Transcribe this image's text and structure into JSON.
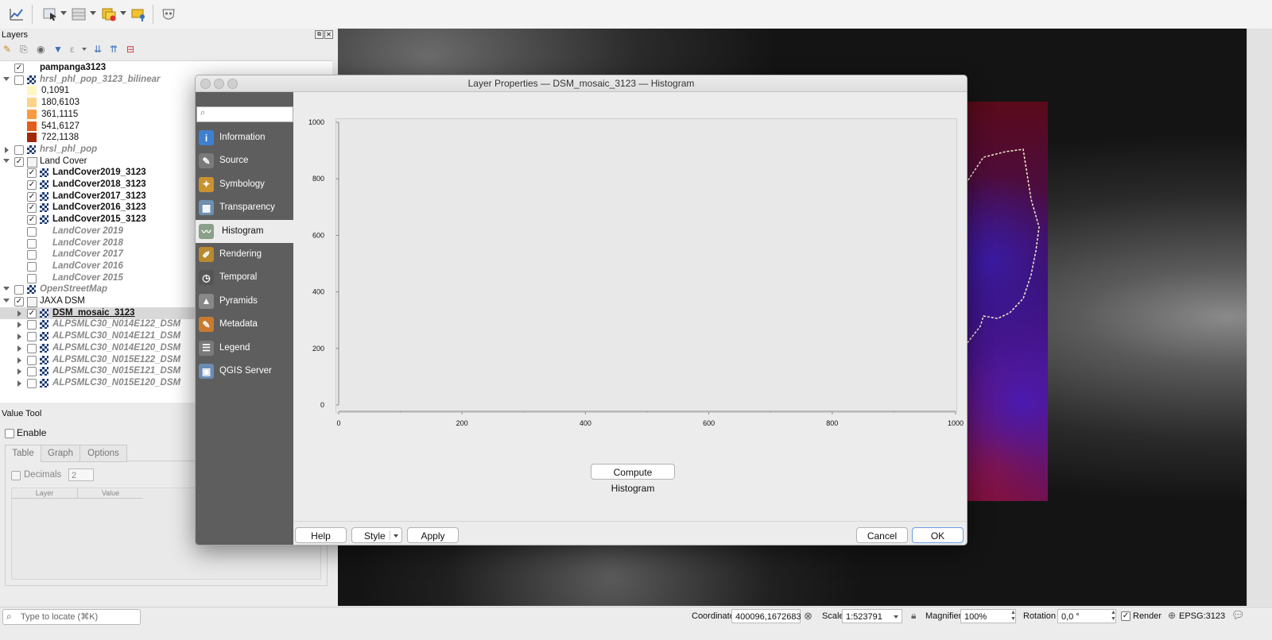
{
  "toolbar": {
    "icons": [
      "profile-chart-icon",
      "select-features-icon",
      "attribute-table-icon",
      "remove-layer-icon",
      "identify-feature-icon",
      "plugin-mask-icon"
    ]
  },
  "layers_panel": {
    "title": "Layers",
    "items": [
      {
        "label": "pampanga3123",
        "style": "b",
        "checked": true,
        "indent": 1,
        "icon": "none",
        "expander": "none"
      },
      {
        "label": "hrsl_phl_pop_3123_bilinear",
        "style": "bi",
        "checked": false,
        "indent": 1,
        "icon": "raster",
        "expander": "down"
      },
      {
        "label": "0,1091",
        "style": "n",
        "swatch": "#fff7c2",
        "indent": 2
      },
      {
        "label": "180,6103",
        "style": "n",
        "swatch": "#fdd38a",
        "indent": 2
      },
      {
        "label": "361,1115",
        "style": "n",
        "swatch": "#fb9b3e",
        "indent": 2
      },
      {
        "label": "541,6127",
        "style": "n",
        "swatch": "#e35d1a",
        "indent": 2
      },
      {
        "label": "722,1138",
        "style": "n",
        "swatch": "#a1290a",
        "indent": 2
      },
      {
        "label": "hrsl_phl_pop",
        "style": "bi",
        "checked": false,
        "indent": 1,
        "icon": "raster",
        "expander": "right"
      },
      {
        "label": "Land Cover",
        "style": "n",
        "checked": true,
        "indent": 1,
        "icon": "group",
        "expander": "down"
      },
      {
        "label": "LandCover2019_3123",
        "style": "b",
        "checked": true,
        "indent": 2,
        "icon": "raster"
      },
      {
        "label": "LandCover2018_3123",
        "style": "b",
        "checked": true,
        "indent": 2,
        "icon": "raster"
      },
      {
        "label": "LandCover2017_3123",
        "style": "b",
        "checked": true,
        "indent": 2,
        "icon": "raster"
      },
      {
        "label": "LandCover2016_3123",
        "style": "b",
        "checked": true,
        "indent": 2,
        "icon": "raster"
      },
      {
        "label": "LandCover2015_3123",
        "style": "b",
        "checked": true,
        "indent": 2,
        "icon": "raster"
      },
      {
        "label": "LandCover 2019",
        "style": "bi",
        "checked": false,
        "indent": 2,
        "icon": "none"
      },
      {
        "label": "LandCover 2018",
        "style": "bi",
        "checked": false,
        "indent": 2,
        "icon": "none"
      },
      {
        "label": "LandCover 2017",
        "style": "bi",
        "checked": false,
        "indent": 2,
        "icon": "none"
      },
      {
        "label": "LandCover 2016",
        "style": "bi",
        "checked": false,
        "indent": 2,
        "icon": "none"
      },
      {
        "label": "LandCover 2015",
        "style": "bi",
        "checked": false,
        "indent": 2,
        "icon": "none"
      },
      {
        "label": "OpenStreetMap",
        "style": "bi",
        "checked": false,
        "indent": 1,
        "icon": "raster",
        "expander": "down"
      },
      {
        "label": "JAXA DSM",
        "style": "n",
        "checked": true,
        "indent": 1,
        "icon": "group",
        "expander": "down"
      },
      {
        "label": "DSM_mosaic_3123",
        "style": "b",
        "checked": true,
        "indent": 2,
        "icon": "raster",
        "expander": "right",
        "selected": true,
        "underline": true
      },
      {
        "label": "ALPSMLC30_N014E122_DSM",
        "style": "bi",
        "checked": false,
        "indent": 2,
        "icon": "raster",
        "expander": "right"
      },
      {
        "label": "ALPSMLC30_N014E121_DSM",
        "style": "bi",
        "checked": false,
        "indent": 2,
        "icon": "raster",
        "expander": "right"
      },
      {
        "label": "ALPSMLC30_N014E120_DSM",
        "style": "bi",
        "checked": false,
        "indent": 2,
        "icon": "raster",
        "expander": "right"
      },
      {
        "label": "ALPSMLC30_N015E122_DSM",
        "style": "bi",
        "checked": false,
        "indent": 2,
        "icon": "raster",
        "expander": "right"
      },
      {
        "label": "ALPSMLC30_N015E121_DSM",
        "style": "bi",
        "checked": false,
        "indent": 2,
        "icon": "raster",
        "expander": "right"
      },
      {
        "label": "ALPSMLC30_N015E120_DSM",
        "style": "bi",
        "checked": false,
        "indent": 2,
        "icon": "raster",
        "expander": "right"
      }
    ]
  },
  "value_tool": {
    "title": "Value Tool",
    "enable_label": "Enable",
    "tabs": [
      "Table",
      "Graph",
      "Options"
    ],
    "decimals_label": "Decimals",
    "decimals_value": "2",
    "columns": [
      "Layer",
      "Value"
    ]
  },
  "dialog": {
    "title": "Layer Properties — DSM_mosaic_3123 — Histogram",
    "search_placeholder": "",
    "nav": [
      {
        "label": "Information",
        "icon": "information-icon",
        "color": "#3f7fcf",
        "glyph": "i"
      },
      {
        "label": "Source",
        "icon": "source-icon",
        "color": "#7a7a7a",
        "glyph": "✎"
      },
      {
        "label": "Symbology",
        "icon": "symbology-icon",
        "color": "#c9922e",
        "glyph": "✦"
      },
      {
        "label": "Transparency",
        "icon": "transparency-icon",
        "color": "#6f8fb0",
        "glyph": "▦"
      },
      {
        "label": "Histogram",
        "icon": "histogram-icon",
        "color": "#8aa08a",
        "glyph": "〰",
        "active": true
      },
      {
        "label": "Rendering",
        "icon": "rendering-icon",
        "color": "#b8892e",
        "glyph": "✐"
      },
      {
        "label": "Temporal",
        "icon": "temporal-icon",
        "color": "#555555",
        "glyph": "◷"
      },
      {
        "label": "Pyramids",
        "icon": "pyramids-icon",
        "color": "#888888",
        "glyph": "▲"
      },
      {
        "label": "Metadata",
        "icon": "metadata-icon",
        "color": "#c97a2e",
        "glyph": "✎"
      },
      {
        "label": "Legend",
        "icon": "legend-icon",
        "color": "#7a7a7a",
        "glyph": "☰"
      },
      {
        "label": "QGIS Server",
        "icon": "qgis-server-icon",
        "color": "#6b8cb5",
        "glyph": "▣"
      }
    ],
    "compute_label": "Compute Histogram",
    "buttons": {
      "help": "Help",
      "style": "Style",
      "apply": "Apply",
      "cancel": "Cancel",
      "ok": "OK"
    }
  },
  "chart_data": {
    "type": "bar",
    "title": "",
    "xlabel": "",
    "ylabel": "",
    "x_ticks": [
      0,
      200,
      400,
      600,
      800,
      1000
    ],
    "y_ticks": [
      0,
      200,
      400,
      600,
      800,
      1000
    ],
    "xlim": [
      0,
      1000
    ],
    "ylim": [
      0,
      1000
    ],
    "series": []
  },
  "statusbar": {
    "locate_placeholder": "Type to locate (⌘K)",
    "coordinate_label": "Coordinate",
    "coordinate_value": "400096,1672683",
    "scale_label": "Scale",
    "scale_value": "1:523791",
    "magnifier_label": "Magnifier",
    "magnifier_value": "100%",
    "rotation_label": "Rotation",
    "rotation_value": "0,0 °",
    "render_label": "Render",
    "crs": "EPSG:3123"
  }
}
